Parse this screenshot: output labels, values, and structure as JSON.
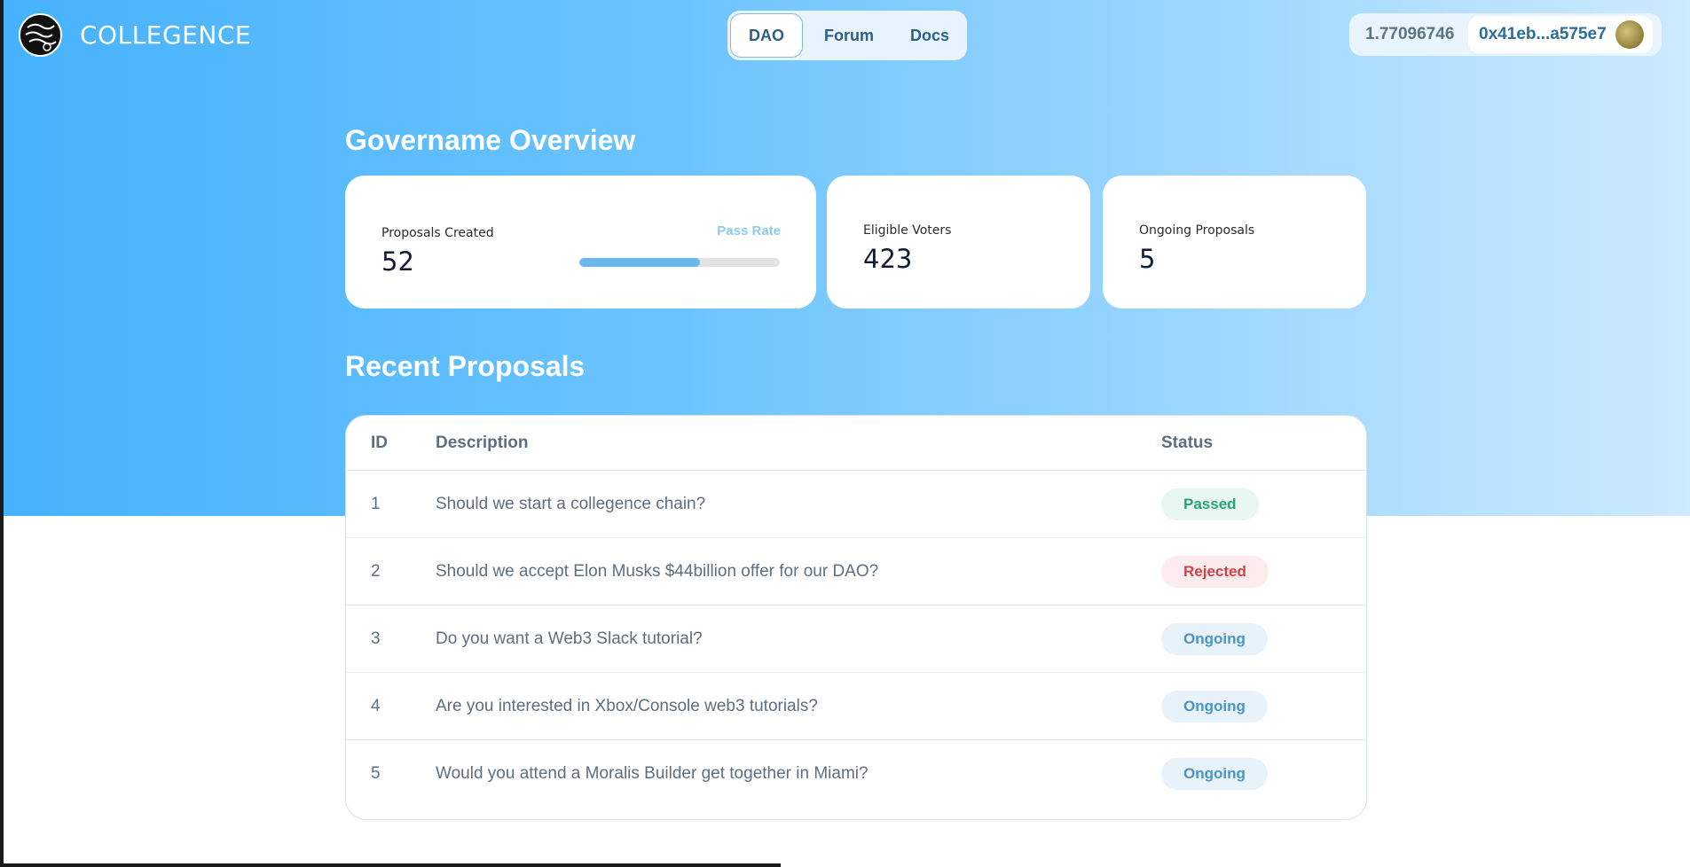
{
  "brand": {
    "name": "COLLEGENCE",
    "logo_icon": "collegence-logo-icon"
  },
  "nav": {
    "items": [
      {
        "label": "DAO",
        "active": true
      },
      {
        "label": "Forum"
      },
      {
        "label": "Docs"
      }
    ]
  },
  "account": {
    "balance": "1.77096746",
    "address": "0x41eb...a575e7",
    "avatar_icon": "avatar-icon"
  },
  "overview": {
    "title": "Govername Overview",
    "proposals_created": {
      "label": "Proposals Created",
      "value": "52"
    },
    "pass_rate": {
      "label": "Pass Rate",
      "fraction": 0.6
    },
    "eligible_voters": {
      "label": "Eligible Voters",
      "value": "423"
    },
    "ongoing_proposals": {
      "label": "Ongoing Proposals",
      "value": "5"
    }
  },
  "recent": {
    "title": "Recent Proposals",
    "columns": [
      "ID",
      "Description",
      "Status"
    ],
    "rows": [
      {
        "id": "1",
        "description": "Should we start a collegence chain?",
        "status": "Passed"
      },
      {
        "id": "2",
        "description": "Should we accept Elon Musks $44billion offer for our DAO?",
        "status": "Rejected"
      },
      {
        "id": "3",
        "description": "Do you want a Web3 Slack tutorial?",
        "status": "Ongoing"
      },
      {
        "id": "4",
        "description": "Are you interested in Xbox/Console web3 tutorials?",
        "status": "Ongoing"
      },
      {
        "id": "5",
        "description": "Would you attend a Moralis Builder get together in Miami?",
        "status": "Ongoing"
      }
    ]
  },
  "colors": {
    "hero_start": "#46b2fd",
    "hero_end": "#cdeaff",
    "passed": "#2aa476",
    "rejected": "#d64048",
    "ongoing": "#4b94c6"
  }
}
